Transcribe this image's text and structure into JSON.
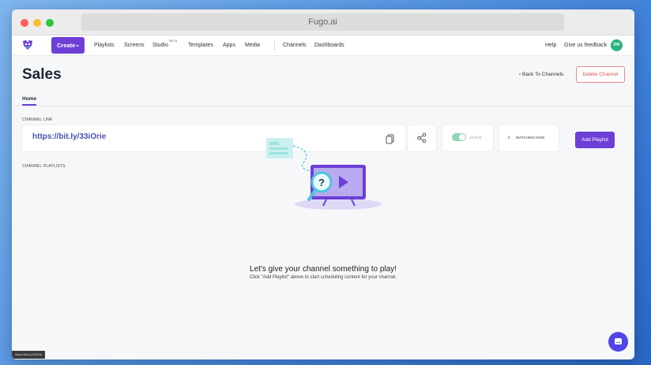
{
  "browser": {
    "address": "Fugo.ai"
  },
  "nav": {
    "create_label": "Create",
    "links": [
      "Playlists",
      "Screens",
      "Studio",
      "Templates",
      "Apps",
      "Media",
      "Channels",
      "Dashboards"
    ],
    "studio_badge": "BETA",
    "help": "Help",
    "feedback": "Give us feedback",
    "avatar_initials": "DR"
  },
  "page": {
    "title": "Sales",
    "back_link": "Back To Channels",
    "delete_label": "Delete Channel",
    "tab_home": "Home"
  },
  "channel_link": {
    "section_label": "CHANNEL LINK",
    "url": "https://bit.ly/33iOrie",
    "toggle_label": "ACTIVE",
    "watching_count": "0",
    "watching_label": "WATCHING NOW",
    "add_playlist": "Add Playlist"
  },
  "playlists": {
    "section_label": "CHANNEL PLAYLISTS",
    "empty_title": "Let's give your channel something to play!",
    "empty_sub": "Click \"Add Playlist\" above to start scheduling content for your channel."
  },
  "status_bar": {
    "url": "https://bit.ly/33iOrie"
  },
  "colors": {
    "accent": "#6d3fd6",
    "danger": "#d9534f",
    "active_green": "#8fd6b4"
  }
}
